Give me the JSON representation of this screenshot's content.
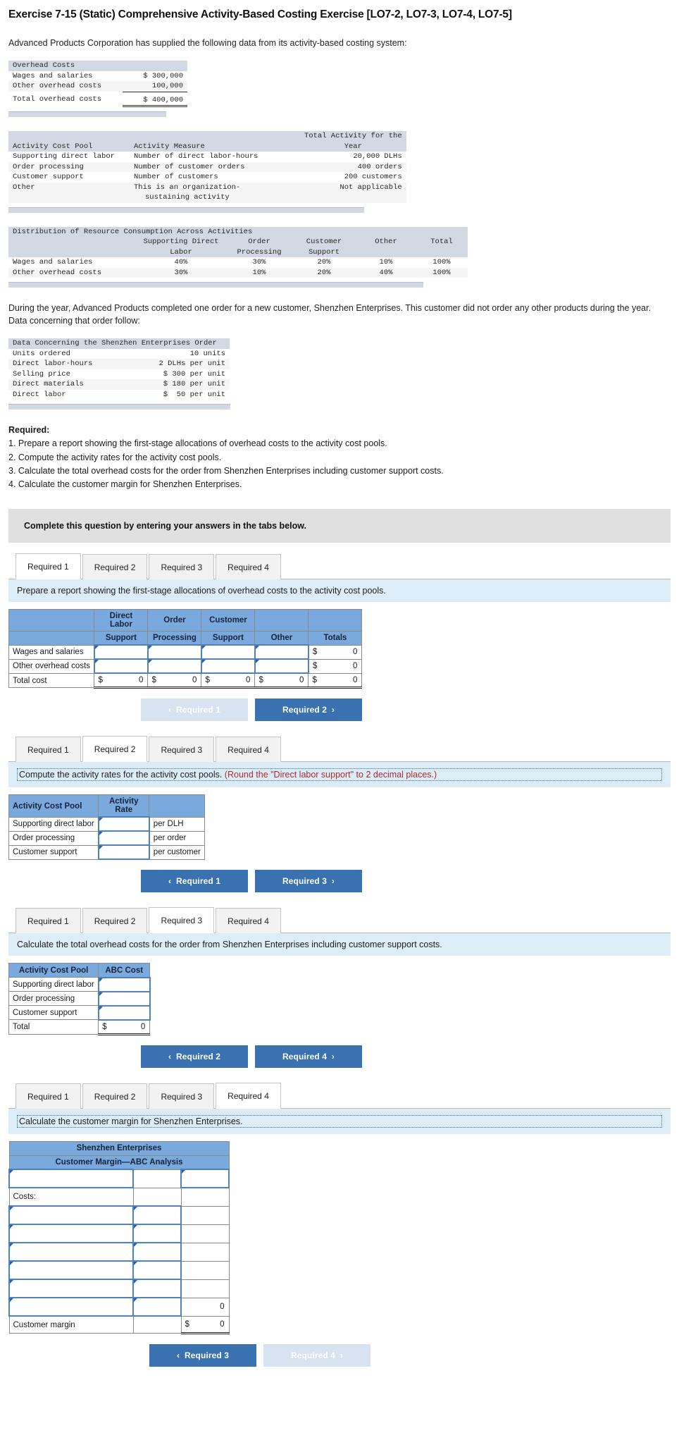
{
  "title": "Exercise 7-15 (Static) Comprehensive Activity-Based Costing Exercise [LO7-2, LO7-3, LO7-4, LO7-5]",
  "intro": "Advanced Products Corporation has supplied the following data from its activity-based costing system:",
  "overhead_costs": {
    "header": "Overhead Costs",
    "rows": [
      {
        "label": "Wages and salaries",
        "value": "$ 300,000"
      },
      {
        "label": "Other overhead costs",
        "value": "100,000"
      },
      {
        "label": "Total overhead costs",
        "value": "$ 400,000"
      }
    ]
  },
  "activity_pools": {
    "col_pool": "Activity Cost Pool",
    "col_measure": "Activity Measure",
    "col_total_line1": "Total Activity for the",
    "col_total_line2": "Year",
    "rows": [
      {
        "pool": "Supporting direct labor",
        "measure": "Number of direct labor-hours",
        "total": "20,000 DLHs"
      },
      {
        "pool": "Order processing",
        "measure": "Number of customer orders",
        "total": "400 orders"
      },
      {
        "pool": "Customer support",
        "measure": "Number of customers",
        "total": "200 customers"
      },
      {
        "pool": "Other",
        "measure": "This is an organization-",
        "measure2": "sustaining activity",
        "total": "Not applicable"
      }
    ]
  },
  "distribution": {
    "header": "Distribution of Resource Consumption Across Activities",
    "columns": [
      "Supporting Direct",
      "Order",
      "Customer",
      "Other",
      "Total"
    ],
    "columns_line2": [
      "Labor",
      "Processing",
      "Support",
      "",
      ""
    ],
    "rows": [
      {
        "label": "Wages and salaries",
        "values": [
          "40%",
          "30%",
          "20%",
          "10%",
          "100%"
        ]
      },
      {
        "label": "Other overhead costs",
        "values": [
          "30%",
          "10%",
          "20%",
          "40%",
          "100%"
        ]
      }
    ]
  },
  "paragraph2": "During the year, Advanced Products completed one order for a new customer, Shenzhen Enterprises. This customer did not order any other products during the year. Data concerning that order follow:",
  "order_data": {
    "header": "Data Concerning the Shenzhen Enterprises Order",
    "rows": [
      {
        "label": "Units ordered",
        "value": "10 units"
      },
      {
        "label": "Direct labor-hours",
        "value": "2 DLHs per unit"
      },
      {
        "label": "Selling price",
        "value": "$ 300 per unit"
      },
      {
        "label": "Direct materials",
        "value": "$ 180 per unit"
      },
      {
        "label": "Direct labor",
        "value": "$  50 per unit"
      }
    ]
  },
  "required": {
    "heading": "Required:",
    "items": [
      "1. Prepare a report showing the first-stage allocations of overhead costs to the activity cost pools.",
      "2. Compute the activity rates for the activity cost pools.",
      "3. Calculate the total overhead costs for the order from Shenzhen Enterprises including customer support costs.",
      "4. Calculate the customer margin for Shenzhen Enterprises."
    ]
  },
  "banner": "Complete this question by entering your answers in the tabs below.",
  "tabs": [
    "Required 1",
    "Required 2",
    "Required 3",
    "Required 4"
  ],
  "section1": {
    "prompt": "Prepare a report showing the first-stage allocations of overhead costs to the activity cost pools.",
    "headers_row1": [
      "",
      "Direct Labor",
      "Order",
      "Customer",
      "",
      ""
    ],
    "headers_row2": [
      "",
      "Support",
      "Processing",
      "Support",
      "Other",
      "Totals"
    ],
    "rows": [
      {
        "label": "Wages and salaries",
        "total_ds": "$",
        "total_val": "0"
      },
      {
        "label": "Other overhead costs",
        "total_ds": "$",
        "total_val": "0"
      }
    ],
    "total_row": {
      "label": "Total cost",
      "cells": [
        {
          "ds": "$",
          "val": "0"
        },
        {
          "ds": "$",
          "val": "0"
        },
        {
          "ds": "$",
          "val": "0"
        },
        {
          "ds": "$",
          "val": "0"
        },
        {
          "ds": "$",
          "val": "0"
        }
      ]
    },
    "prev_btn": "Required 1",
    "next_btn": "Required 2"
  },
  "section2": {
    "prompt_main": "Compute the activity rates for the activity cost pools. ",
    "prompt_note": "(Round the \"Direct labor support\" to 2 decimal places.)",
    "headers": [
      "Activity Cost Pool",
      "Activity Rate",
      ""
    ],
    "rows": [
      {
        "label": "Supporting direct labor",
        "unit": "per DLH"
      },
      {
        "label": "Order processing",
        "unit": "per order"
      },
      {
        "label": "Customer support",
        "unit": "per customer"
      }
    ],
    "prev_btn": "Required 1",
    "next_btn": "Required 3"
  },
  "section3": {
    "prompt": "Calculate the total overhead costs for the order from Shenzhen Enterprises including customer support costs.",
    "headers": [
      "Activity Cost Pool",
      "ABC Cost"
    ],
    "rows": [
      {
        "label": "Supporting direct labor"
      },
      {
        "label": "Order processing"
      },
      {
        "label": "Customer support"
      }
    ],
    "total_label": "Total",
    "total_ds": "$",
    "total_val": "0",
    "prev_btn": "Required 2",
    "next_btn": "Required 4"
  },
  "section4": {
    "prompt": "Calculate the customer margin for Shenzhen Enterprises.",
    "title1": "Shenzhen Enterprises",
    "title2": "Customer Margin—ABC Analysis",
    "costs_label": "Costs:",
    "subtotal_val": "0",
    "margin_label": "Customer margin",
    "margin_ds": "$",
    "margin_val": "0",
    "prev_btn": "Required 3",
    "next_btn": "Required 4"
  },
  "icons": {
    "chev_left": "‹",
    "chev_right": "›"
  }
}
